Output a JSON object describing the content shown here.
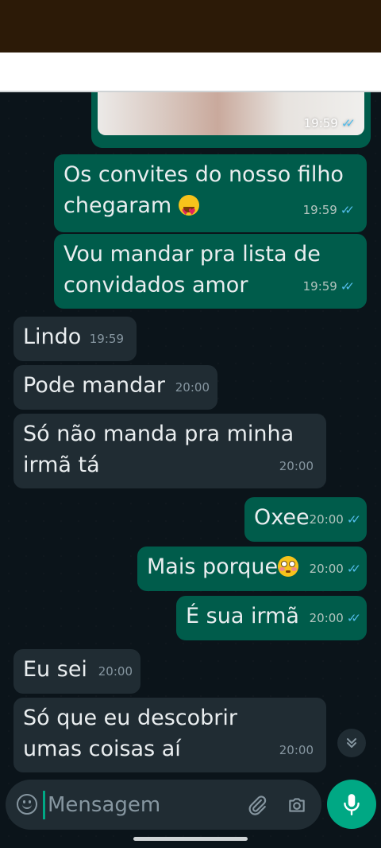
{
  "chat": {
    "image_message": {
      "time": "19:59",
      "ticks": "✓✓"
    },
    "messages": [
      {
        "dir": "out",
        "text": "Os convites do nosso filho chegaram ",
        "emoji": "heart-eyes-emoji",
        "time": "19:59",
        "ticks": "✓✓"
      },
      {
        "dir": "out",
        "text": "Vou mandar pra lista de convidados amor",
        "time": "19:59",
        "ticks": "✓✓"
      },
      {
        "dir": "in",
        "text": "Lindo",
        "time": "19:59"
      },
      {
        "dir": "in",
        "text": "Pode mandar",
        "time": "20:00"
      },
      {
        "dir": "in",
        "text": "Só não manda pra minha irmã tá",
        "time": "20:00"
      },
      {
        "dir": "out",
        "text": "Oxee",
        "time": "20:00",
        "ticks": "✓✓"
      },
      {
        "dir": "out",
        "text": "Mais porque",
        "emoji": "flushed-face-emoji",
        "time": "20:00",
        "ticks": "✓✓"
      },
      {
        "dir": "out",
        "text": "É sua irmã",
        "time": "20:00",
        "ticks": "✓✓"
      },
      {
        "dir": "in",
        "text": "Eu sei",
        "time": "20:00"
      },
      {
        "dir": "in",
        "text": "Só que eu descobrir umas coisas aí",
        "time": "20:00"
      }
    ],
    "scroll_icon": "double-chevron-down-icon"
  },
  "composer": {
    "placeholder": "Mensagem",
    "emoji_icon": "emoji-icon",
    "attach_icon": "paperclip-icon",
    "camera_icon": "camera-icon",
    "mic_icon": "microphone-icon"
  },
  "colors": {
    "chat_background": "#0b141a",
    "outgoing_bubble": "#005c4b",
    "incoming_bubble": "#202c33",
    "read_ticks": "#53bdeb",
    "accent": "#00a884",
    "status_bar": "#2c1a07"
  }
}
